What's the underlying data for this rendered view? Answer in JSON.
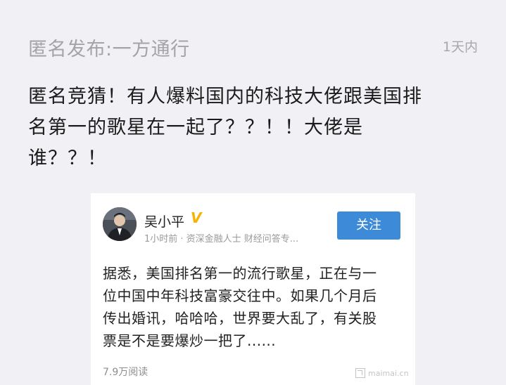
{
  "post": {
    "poster": "匿名发布:一方通行",
    "time": "1天内",
    "text_lines": [
      "匿名竞猜！有人爆料国内的科技大佬跟美国排",
      "名第一的歌星在一起了？？！！大佬是",
      "谁？？！"
    ]
  },
  "card": {
    "author_name": "吴小平",
    "verified_badge": "V",
    "author_meta": "1小时前 · 资深金融人士 财经问答专...",
    "follow_label": "关注",
    "content_lines": [
      "据悉，美国排名第一的流行歌星，正在与一",
      "位中国中年科技富豪交往中。如果几个月后",
      "传出婚讯，哈哈哈，世界要大乱了，有关股",
      "票是不是要爆炒一把了......"
    ],
    "read_count": "7.9万阅读",
    "watermark": "maimai.cn"
  },
  "colors": {
    "page_background": "#f1f1f5",
    "follow_button": "#3d8ad8",
    "verified": "#f4b400"
  },
  "icons": {
    "verified": "verified-v-icon",
    "watermark": "maimai-logo-icon"
  }
}
